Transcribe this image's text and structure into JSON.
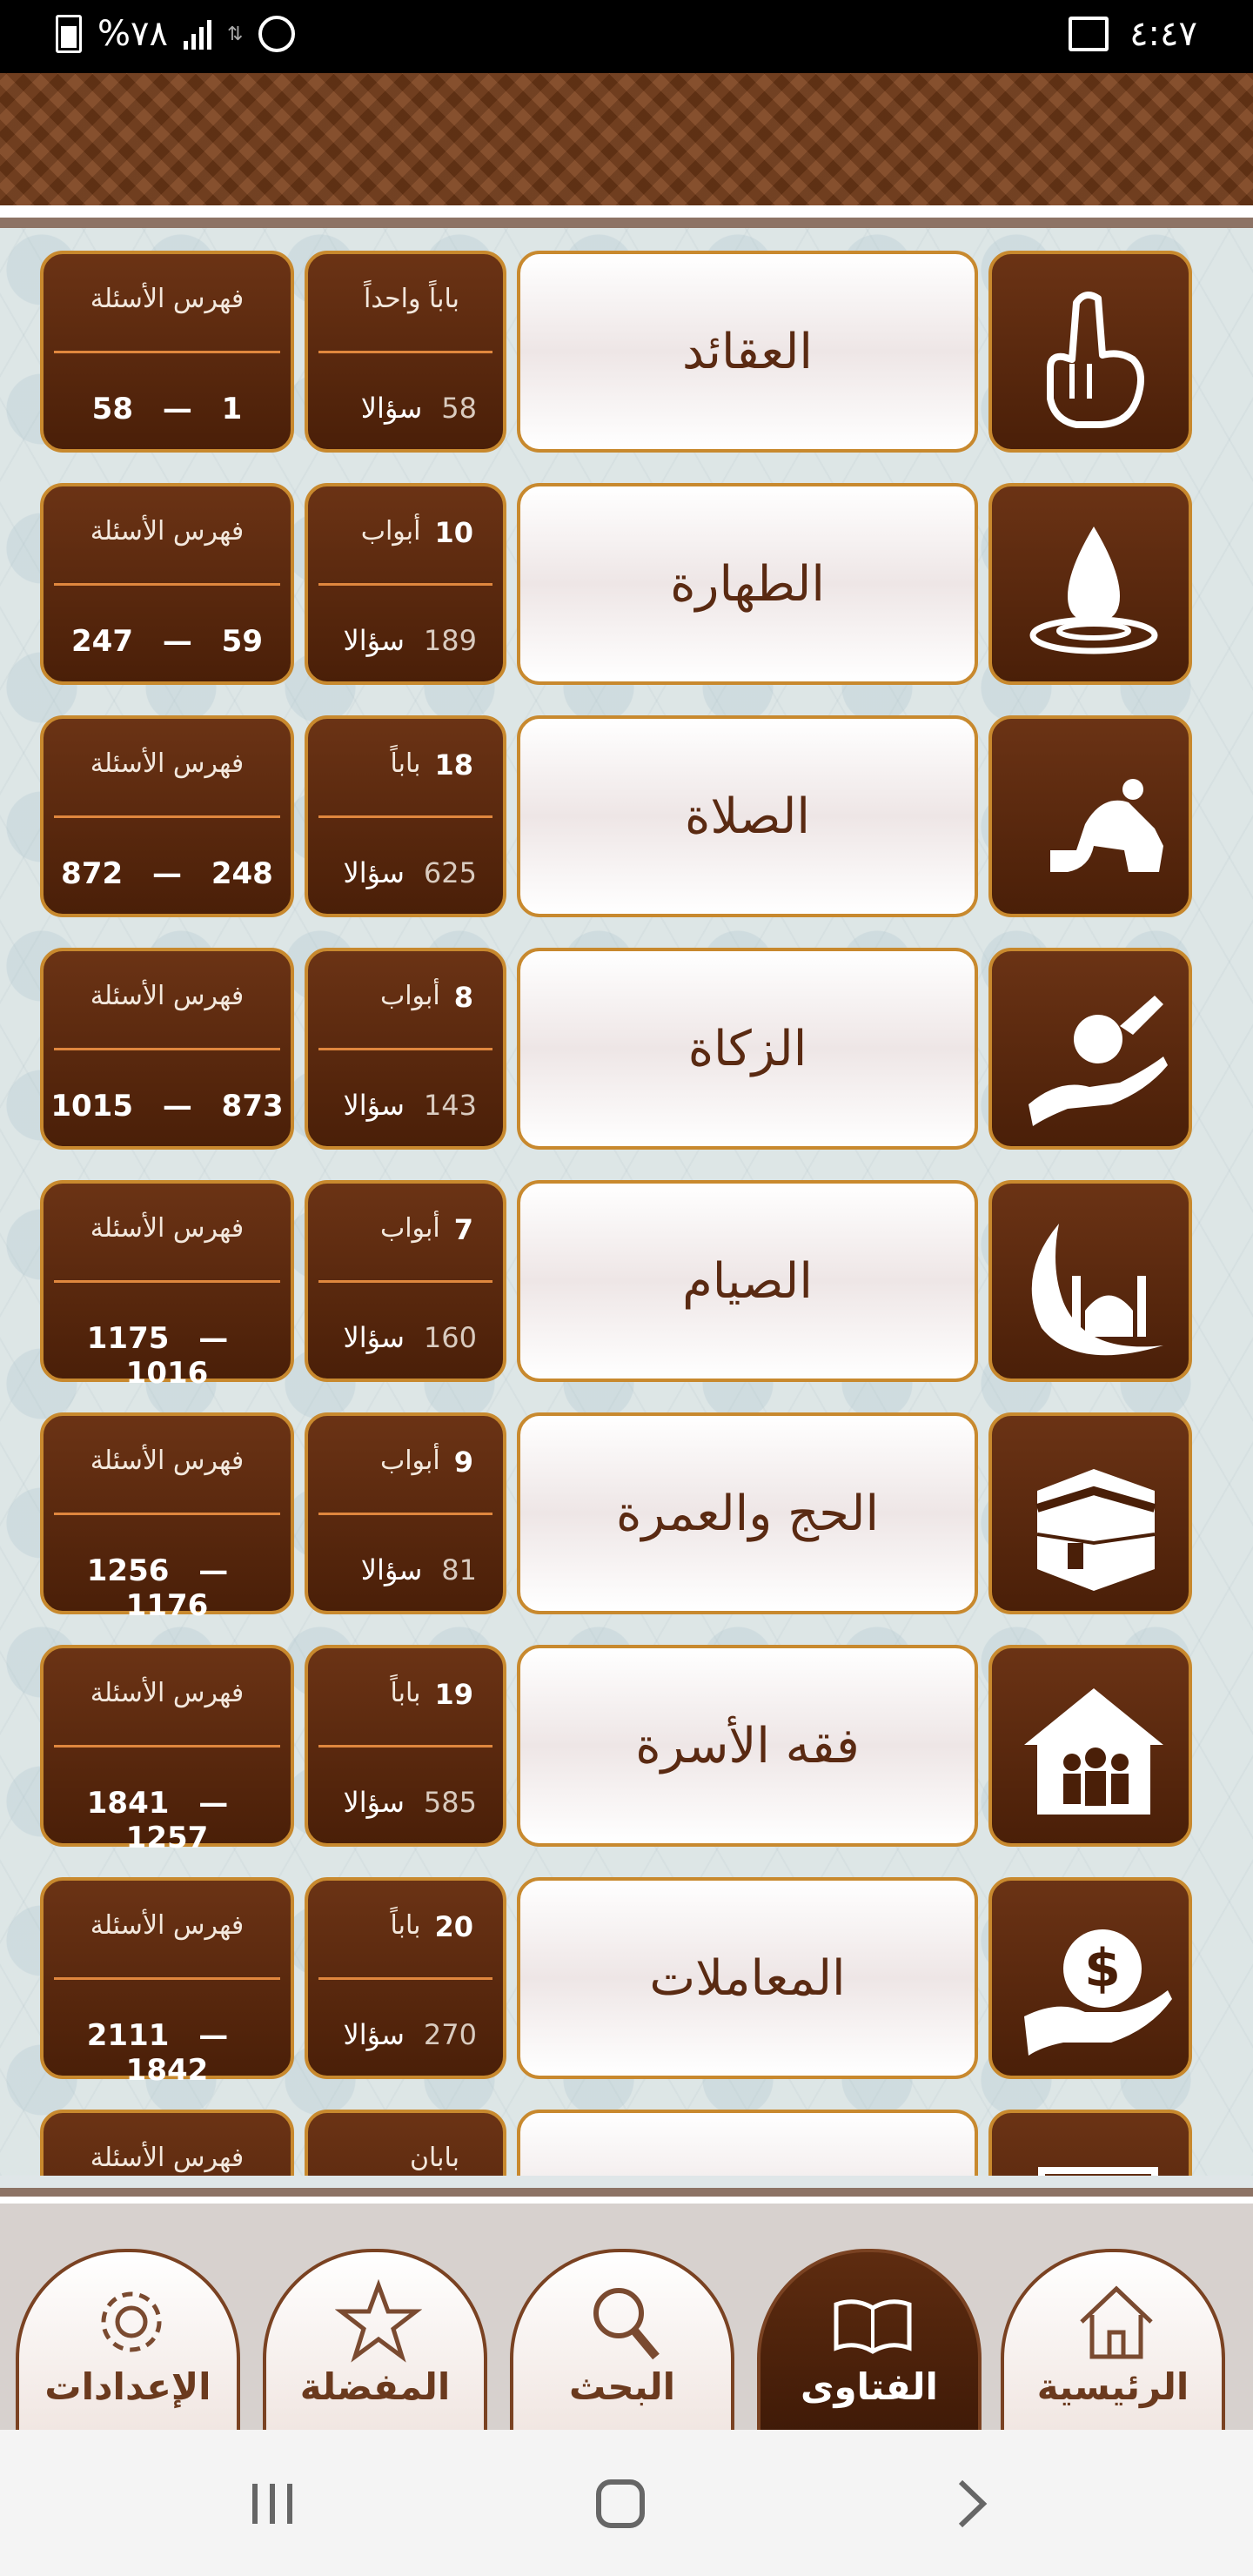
{
  "status_bar": {
    "battery_text": "%٧٨",
    "time": "٤:٤٧"
  },
  "rows": [
    {
      "title": "العقائد",
      "icon": "pointing-finger-icon",
      "count_top_label": "باباً واحداً",
      "count_top_num": "",
      "questions_num": "58",
      "questions_label": "سؤالا",
      "index_label": "فهرس الأسئلة",
      "index_from": "1",
      "index_to": "58"
    },
    {
      "title": "الطهارة",
      "icon": "water-drop-icon",
      "count_top_label": "أبواب",
      "count_top_num": "10",
      "questions_num": "189",
      "questions_label": "سؤالا",
      "index_label": "فهرس الأسئلة",
      "index_from": "59",
      "index_to": "247"
    },
    {
      "title": "الصلاة",
      "icon": "prostrating-person-icon",
      "count_top_label": "باباً",
      "count_top_num": "18",
      "questions_num": "625",
      "questions_label": "سؤالا",
      "index_label": "فهرس الأسئلة",
      "index_from": "248",
      "index_to": "872"
    },
    {
      "title": "الزكاة",
      "icon": "giving-hand-icon",
      "count_top_label": "أبواب",
      "count_top_num": "8",
      "questions_num": "143",
      "questions_label": "سؤالا",
      "index_label": "فهرس الأسئلة",
      "index_from": "873",
      "index_to": "1015"
    },
    {
      "title": "الصيام",
      "icon": "crescent-mosque-icon",
      "count_top_label": "أبواب",
      "count_top_num": "7",
      "questions_num": "160",
      "questions_label": "سؤالا",
      "index_label": "فهرس الأسئلة",
      "index_from": "1016",
      "index_to": "1175"
    },
    {
      "title": "الحج والعمرة",
      "icon": "kaaba-icon",
      "count_top_label": "أبواب",
      "count_top_num": "9",
      "questions_num": "81",
      "questions_label": "سؤالا",
      "index_label": "فهرس الأسئلة",
      "index_from": "1176",
      "index_to": "1256"
    },
    {
      "title": "فقه الأسرة",
      "icon": "family-house-icon",
      "count_top_label": "باباً",
      "count_top_num": "19",
      "questions_num": "585",
      "questions_label": "سؤالا",
      "index_label": "فهرس الأسئلة",
      "index_from": "1257",
      "index_to": "1841"
    },
    {
      "title": "المعاملات",
      "icon": "money-hand-icon",
      "count_top_label": "باباً",
      "count_top_num": "20",
      "questions_num": "270",
      "questions_label": "سؤالا",
      "index_label": "فهرس الأسئلة",
      "index_from": "1842",
      "index_to": "2111"
    },
    {
      "title": "",
      "icon": "document-icon",
      "count_top_label": "بابان",
      "count_top_num": "",
      "questions_num": "",
      "questions_label": "",
      "index_label": "فهرس الأسئلة",
      "index_from": "",
      "index_to": ""
    }
  ],
  "tabs": [
    {
      "label": "الرئيسية",
      "icon": "home-icon",
      "active": false
    },
    {
      "label": "الفتاوى",
      "icon": "open-book-icon",
      "active": true
    },
    {
      "label": "البحث",
      "icon": "search-icon",
      "active": false
    },
    {
      "label": "المفضلة",
      "icon": "star-icon",
      "active": false
    },
    {
      "label": "الإعدادات",
      "icon": "gear-icon",
      "active": false
    }
  ],
  "colors": {
    "brown_dark": "#4a1f08",
    "brown": "#6b3315",
    "gold_border": "#c8892e",
    "separator_orange": "#e0873e"
  }
}
